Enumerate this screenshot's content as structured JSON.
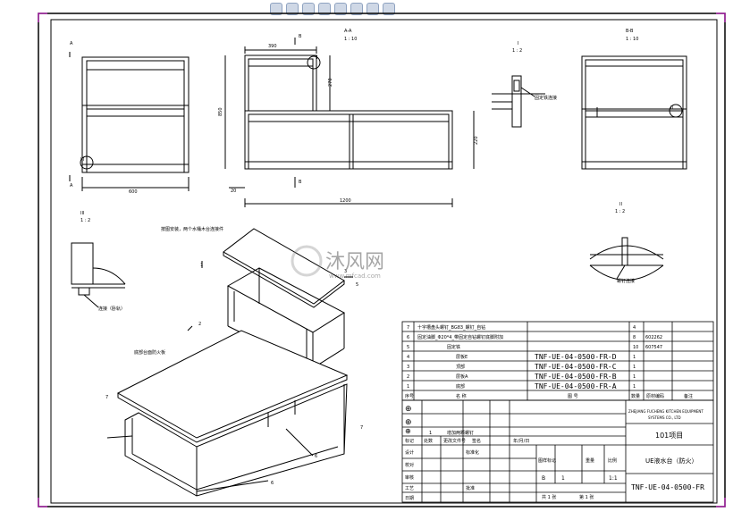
{
  "toolbar": {
    "icons": [
      "zoom-icon",
      "pan-icon",
      "rotate-icon",
      "view-icon",
      "display-icon",
      "section-icon",
      "appearance-icon",
      "scene-icon"
    ]
  },
  "views": {
    "sectionAA": {
      "label": "A-A",
      "scale": "1 : 10"
    },
    "detailI": {
      "label": "I",
      "scale": "1 : 2",
      "callout": "固定铁连接"
    },
    "sectionBB": {
      "label": "B-B",
      "scale": "1 : 10"
    },
    "detailIII": {
      "label": "III",
      "scale": "1 : 2",
      "callout": "连接（卧轨）"
    },
    "detailII": {
      "label": "II",
      "scale": "1 : 2",
      "callout": "螺钉连接"
    },
    "markers": {
      "a": "A",
      "b": "B",
      "roman1": "I",
      "roman2": "II",
      "roman3": "III"
    }
  },
  "dimensions": {
    "d390": "390",
    "d850": "850",
    "d270": "270",
    "d220": "220",
    "d600": "600",
    "d20": "20",
    "d1200": "1200"
  },
  "iso_notes": {
    "top": "按图安装，两个水桶木台连接件",
    "left": "底部台面防火板"
  },
  "balloons": [
    "1",
    "2",
    "3",
    "4",
    "5",
    "6",
    "7"
  ],
  "bom": {
    "rows": [
      {
        "no": "7",
        "name": "十字槽盘头螺钉_BG83_螺钉_自钻",
        "code": "",
        "qty": "4",
        "note": ""
      },
      {
        "no": "6",
        "name": "固定油脚_Φ20*4_带固定自钻螺钉底脚附加",
        "code": "",
        "qty": "8",
        "note": "602262"
      },
      {
        "no": "5",
        "name": "固定铁",
        "code": "",
        "qty": "10",
        "note": "607547"
      },
      {
        "no": "4",
        "name": "层板E",
        "code": "TNF-UE-04-0500-FR-D",
        "qty": "1",
        "note": ""
      },
      {
        "no": "3",
        "name": "顶部",
        "code": "TNF-UE-04-0500-FR-C",
        "qty": "1",
        "note": ""
      },
      {
        "no": "2",
        "name": "层板A",
        "code": "TNF-UE-04-0500-FR-B",
        "qty": "1",
        "note": ""
      },
      {
        "no": "1",
        "name": "底部",
        "code": "TNF-UE-04-0500-FR-A",
        "qty": "1",
        "note": ""
      }
    ],
    "header": {
      "no": "序号",
      "name": "名    称",
      "code": "图    号",
      "qty": "数量",
      "mat": "原材编码",
      "note": "备注"
    }
  },
  "revision": {
    "row1": {
      "mark": "1",
      "text": "增加两颗螺钉"
    },
    "header": [
      "标记",
      "处数",
      "更改文件号",
      "签名",
      "年/月/日"
    ],
    "symbols": [
      "⊕",
      "⊕",
      "⊕"
    ]
  },
  "signoff": {
    "design": "设计",
    "standard": "标准化",
    "check": "校对",
    "process": "工艺",
    "audit": "审核",
    "approve": "批准",
    "date": "日期"
  },
  "stage": {
    "label": "图样标记",
    "b": "B",
    "weight": "重量",
    "scale_label": "比例",
    "num": "1",
    "scale": "1:1",
    "count": "共 1 张",
    "sheet": "第 1 张"
  },
  "company": {
    "line1": "ZHEJIANG FUCHENG KITCHEN EQUIPMENT",
    "line2": "SYSTEMS CO., LTD"
  },
  "title": {
    "project": "101项目",
    "part": "UE液水台（防火）",
    "drawing_no": "TNF-UE-04-0500-FR"
  },
  "watermark": {
    "brand": "沐风网",
    "url": "www.mfcad.com"
  }
}
